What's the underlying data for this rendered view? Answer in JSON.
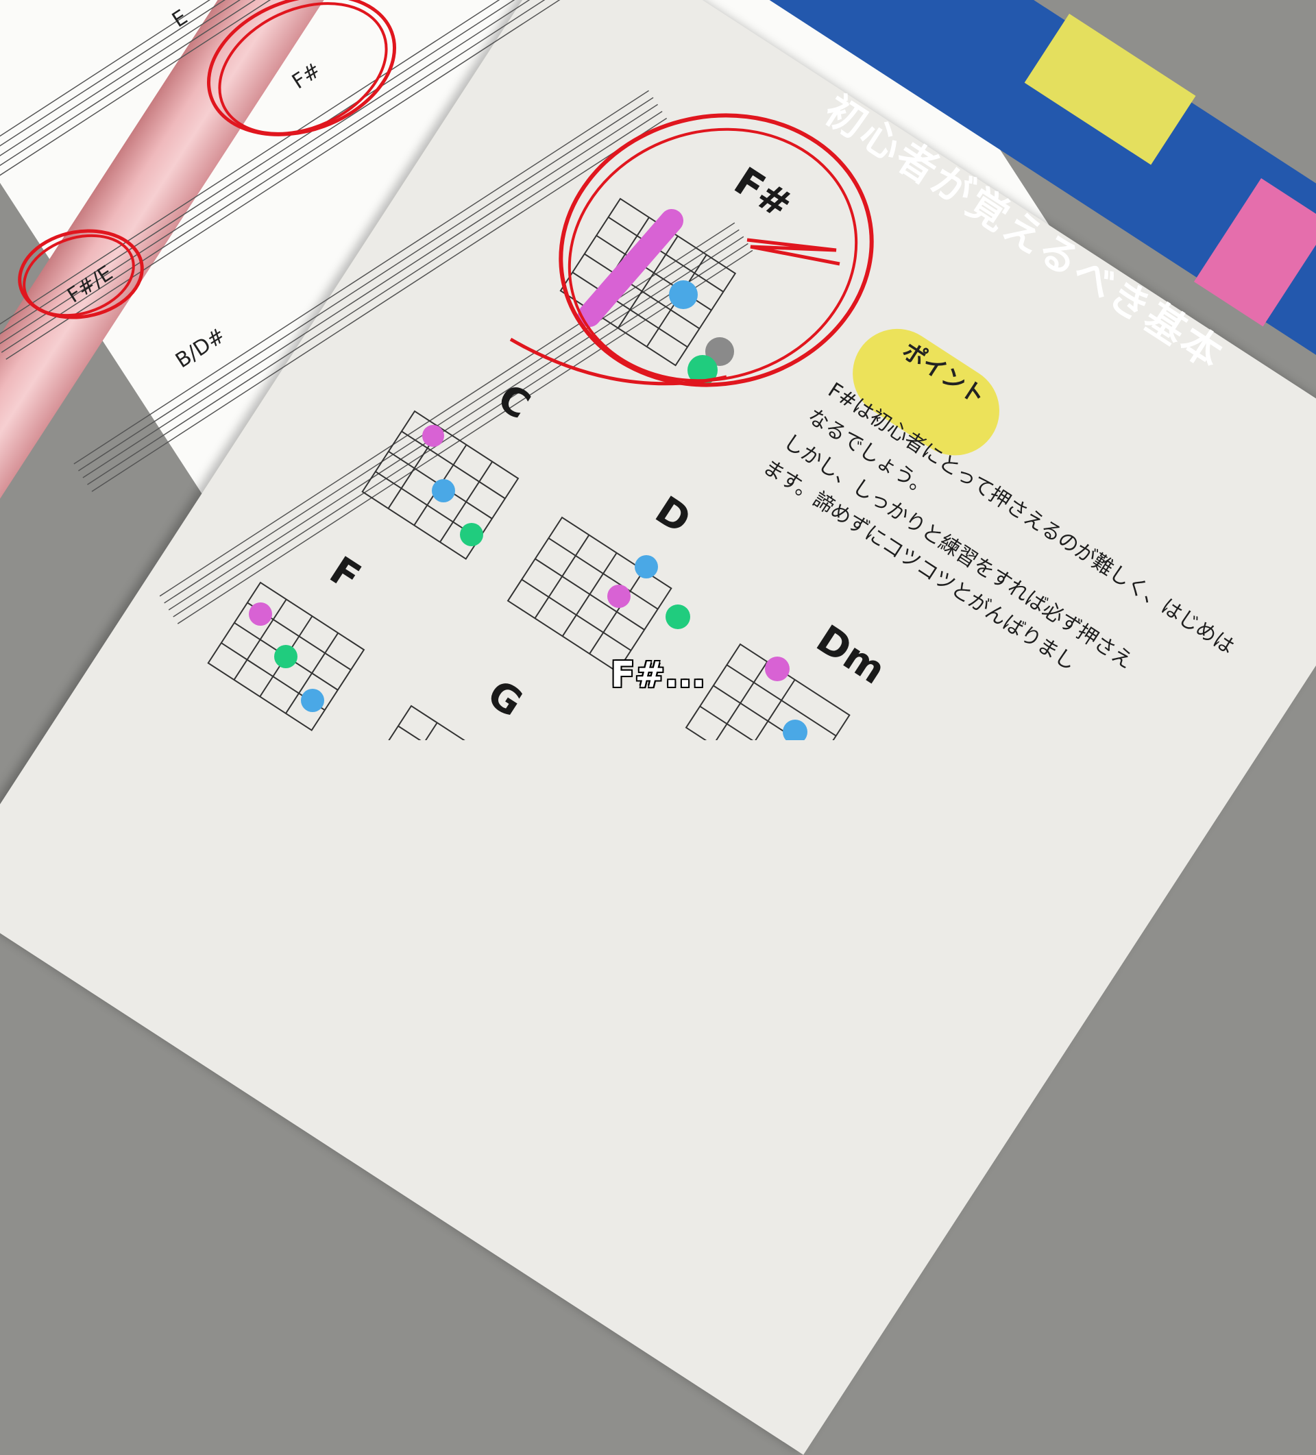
{
  "scene": {
    "book_title": "初心者が覚えるべき基本",
    "point_label": "ポイント",
    "point_text": [
      "F#は初心者にとって押さえるのが難しく、はじめは",
      "なるでしょう。",
      "しかし、しっかりと練習をすれば必ず押さえ",
      "ます。諦めずにコツコツとがんばりまし"
    ],
    "chords": {
      "featured": "F#",
      "c": "C",
      "d": "D",
      "f": "F",
      "g": "G",
      "dm": "Dm"
    },
    "sheet_chords": [
      "F#",
      "F#/E",
      "B/D#",
      "E"
    ],
    "subtitle": "F#...",
    "colors": {
      "banner": "#2358ad",
      "binder": "#efb9bc",
      "circle": "#e0161e",
      "dot_blue": "#4aa8e6",
      "dot_green": "#20cc7e",
      "dot_pink": "#d862d4",
      "badge": "#ece25a"
    }
  }
}
